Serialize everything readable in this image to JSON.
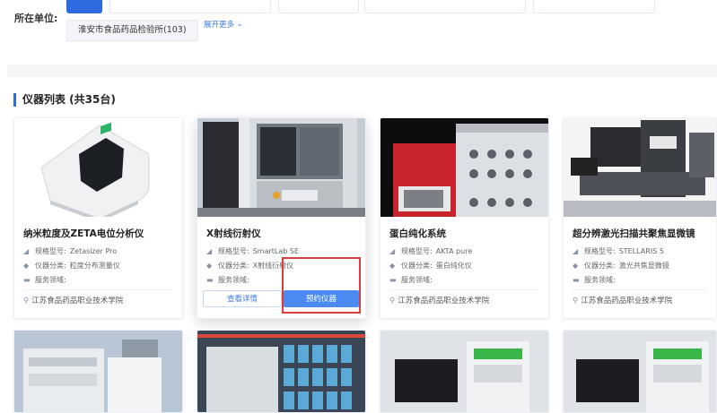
{
  "filter": {
    "label": "所在单位:",
    "unit_chip": "淮安市食品药品检验所(103)",
    "expand_more": "展开更多",
    "accent": "#2f6be0"
  },
  "list": {
    "heading": "仪器列表 (共35台)"
  },
  "labels": {
    "model": "规格型号:",
    "category": "仪器分类:",
    "service": "服务领域:"
  },
  "cards": [
    {
      "title": "纳米粒度及ZETA电位分析仪",
      "model": "Zetasizer Pro",
      "category": "粒度分布测量仪",
      "service": "",
      "org": "江苏食品药品职业技术学院"
    },
    {
      "title": "X射线衍射仪",
      "model": "SmartLab SE",
      "category": "X射线衍射仪",
      "service": "",
      "buttons": {
        "view": "查看详情",
        "book": "预约仪器"
      }
    },
    {
      "title": "蛋白纯化系统",
      "model": "AKTA pure",
      "category": "蛋白纯化仪",
      "service": "",
      "org": "江苏食品药品职业技术学院"
    },
    {
      "title": "超分辨激光扫描共聚焦显微镜",
      "model": "STELLARIS 5",
      "category": "激光共焦显微镜",
      "service": "",
      "org": "江苏食品药品职业技术学院"
    }
  ],
  "icons": {
    "model": "ruler-icon",
    "category": "tag-icon",
    "service": "folder-icon",
    "org": "location-pin-icon"
  },
  "colors": {
    "primary_button": "#4b8af0",
    "highlight_box": "#e03c3c"
  }
}
